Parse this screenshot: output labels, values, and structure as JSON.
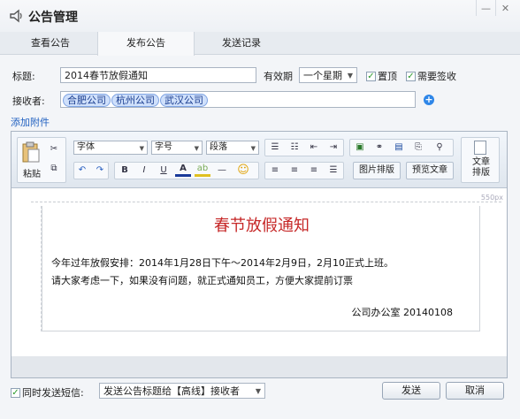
{
  "window": {
    "title": "公告管理"
  },
  "tabs": [
    {
      "label": "查看公告"
    },
    {
      "label": "发布公告"
    },
    {
      "label": "发送记录"
    }
  ],
  "form": {
    "title_label": "标题:",
    "title_value": "2014春节放假通知",
    "validity_label": "有效期",
    "validity_value": "一个星期",
    "pin_label": "置顶",
    "pin_checked": true,
    "sign_label": "需要签收",
    "sign_checked": true,
    "recipients_label": "接收者:",
    "recipients": [
      "合肥公司",
      "杭州公司",
      "武汉公司"
    ],
    "attach_link": "添加附件"
  },
  "toolbar": {
    "paste_label": "粘贴",
    "font_family": "字体",
    "font_size": "字号",
    "paragraph": "段落",
    "image_layout": "图片排版",
    "preview": "预览文章",
    "article_layout_1": "文章",
    "article_layout_2": "排版"
  },
  "document": {
    "ruler_label": "550px",
    "heading": "春节放假通知",
    "line1": "今年过年放假安排：2014年1月28日下午～2014年2月9日，2月10正式上班。",
    "line2": "请大家考虑一下，如果没有问题，就正式通知员工，方便大家提前订票",
    "signature": "公司办公室 20140108"
  },
  "footer": {
    "sms_label": "同时发送短信:",
    "sms_checked": true,
    "sms_option": "发送公告标题给【高线】接收者",
    "send_label": "发送",
    "cancel_label": "取消"
  },
  "colors": {
    "accent": "#2e86e8",
    "heading": "#c62828",
    "chip": "#cfe0fb"
  }
}
